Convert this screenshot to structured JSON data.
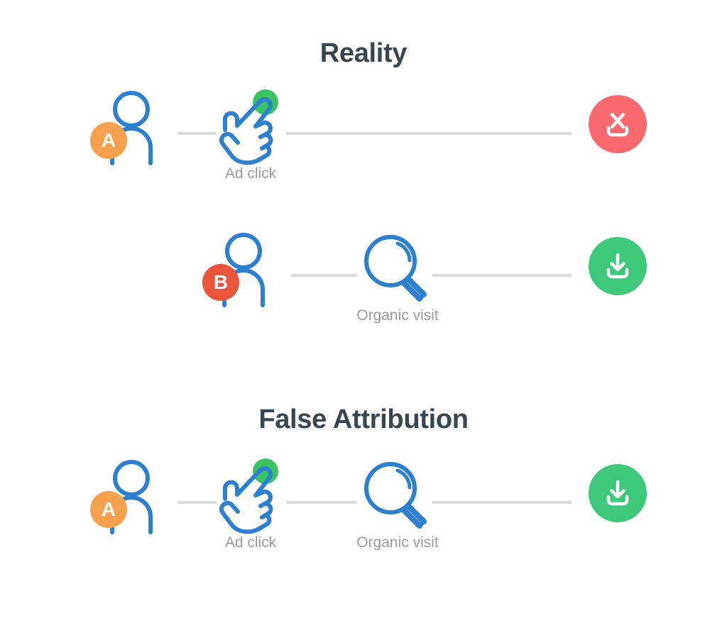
{
  "diagram": {
    "type": "flow-comparison",
    "background_color": "#ffffff",
    "sections": [
      {
        "id": "reality",
        "title": "Reality",
        "title_color": "#37464f",
        "rows": [
          {
            "id": "reality-user-a",
            "user_badge": "A",
            "user_badge_color": "#f4a04c",
            "steps": [
              {
                "icon": "user-icon",
                "label": ""
              },
              {
                "icon": "ad-click-hand-icon",
                "label": "Ad click"
              }
            ],
            "outcome": {
              "icon": "download-failed-icon",
              "label": "",
              "color": "#f96a6e"
            }
          },
          {
            "id": "reality-user-b",
            "user_badge": "B",
            "user_badge_color": "#e8553a",
            "steps": [
              {
                "icon": "user-icon",
                "label": ""
              },
              {
                "icon": "magnifier-icon",
                "label": "Organic visit"
              }
            ],
            "outcome": {
              "icon": "download-success-icon",
              "label": "",
              "color": "#3dc87a"
            }
          }
        ]
      },
      {
        "id": "false-attribution",
        "title": "False Attribution",
        "title_color": "#37464f",
        "rows": [
          {
            "id": "false-user-a",
            "user_badge": "A",
            "user_badge_color": "#f4a04c",
            "steps": [
              {
                "icon": "user-icon",
                "label": ""
              },
              {
                "icon": "ad-click-hand-icon",
                "label": "Ad click"
              },
              {
                "icon": "magnifier-icon",
                "label": "Organic visit"
              }
            ],
            "outcome": {
              "icon": "download-success-icon",
              "label": "",
              "color": "#3dc87a"
            }
          }
        ]
      }
    ],
    "colors": {
      "line_stroke": "#dadada",
      "icon_blue": "#2d7fd0",
      "accent_green": "#3bc363",
      "caption_gray": "#9b9b9b",
      "orange_badge": "#f4a04c",
      "red_badge": "#e8553a",
      "fail_circle": "#f96a6e",
      "success_circle": "#3dc87a"
    }
  }
}
